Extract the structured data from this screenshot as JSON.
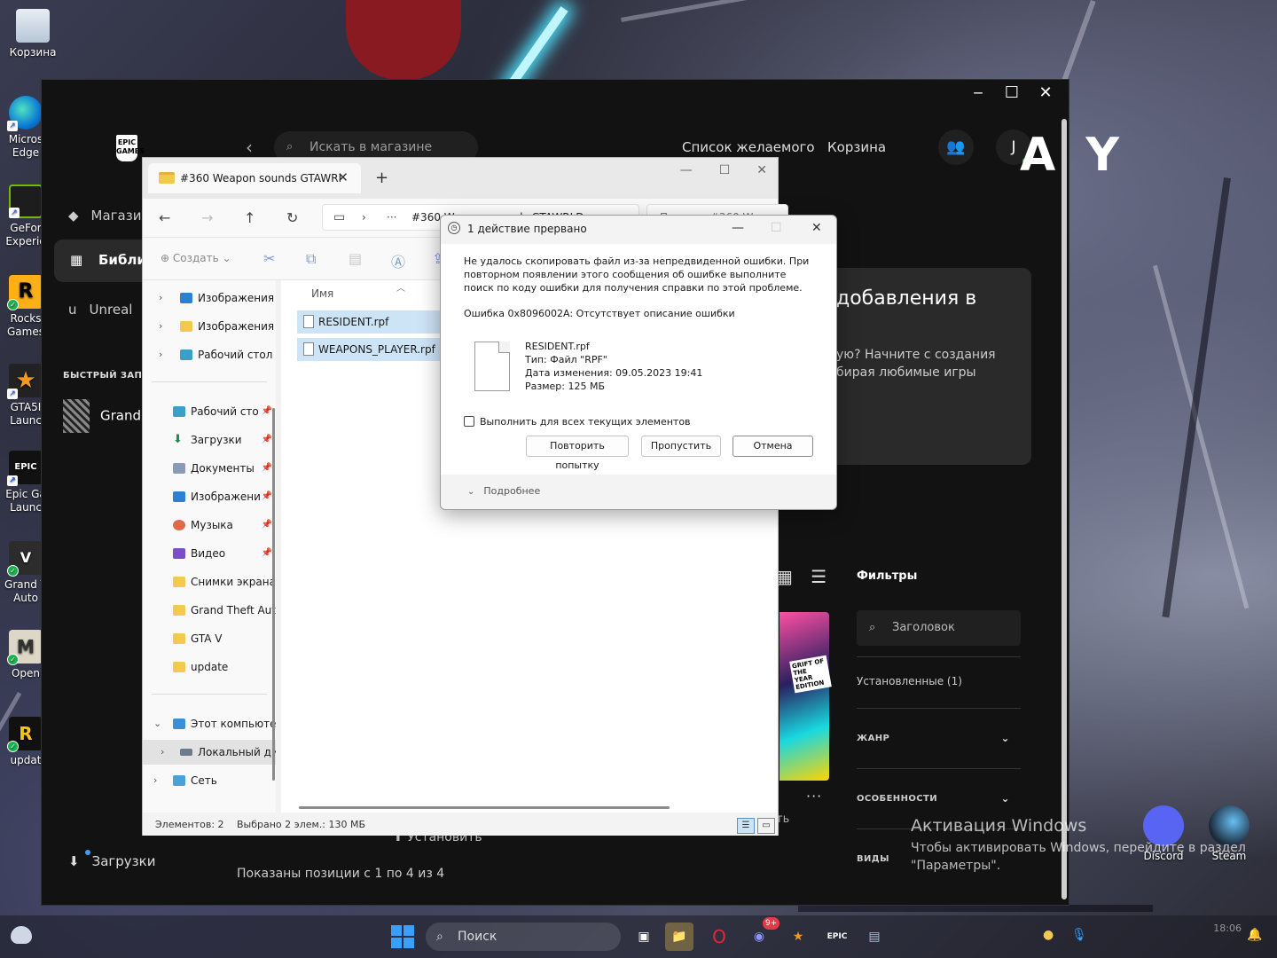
{
  "desktop": {
    "icons": [
      {
        "label": "Корзина"
      },
      {
        "label": "Micros Edge"
      },
      {
        "label": "GeFor Experie"
      },
      {
        "label": "Rocks Games"
      },
      {
        "label": "GTA5I Launc"
      },
      {
        "label": "Epic Ga Launc"
      },
      {
        "label": "Grand T Auto"
      },
      {
        "label": "Open"
      },
      {
        "label": "updat"
      }
    ],
    "right_apps": [
      {
        "label": "Discord"
      },
      {
        "label": "Steam"
      }
    ],
    "activation": {
      "title": "Активация Windows",
      "line1": "Чтобы активировать Windows, перейдите в раздел",
      "line2": "\"Параметры\"."
    }
  },
  "epic": {
    "logo": "EPIC GAMES",
    "search_placeholder": "Искать в магазине",
    "wishlist": "Список желаемого",
    "cart": "Корзина",
    "avatar_letter": "J",
    "sidebar": {
      "store": "Магазин",
      "library": "Библиотека",
      "unreal": "Unreal",
      "quick_launch": "БЫСТРЫЙ ЗАПУСК",
      "gta": "Grand T",
      "downloads": "Загрузки"
    },
    "card": {
      "title": "добавления в",
      "text": "ую? Начните с создания бирая любимые игры"
    },
    "filters": {
      "title": "Фильтры",
      "search_placeholder": "Заголовок",
      "installed": "Установленные (1)",
      "genre": "ЖАНР",
      "features": "ОСОБЕННОСТИ",
      "types": "ВИДЫ"
    },
    "game_cover_label": "GRIFT OF THE YEAR EDITION",
    "more": "···",
    "ts": "ть",
    "install": "Установить",
    "shown": "Показаны позиции с 1 по 4 из 4",
    "brand": "A Y"
  },
  "explorer": {
    "tab_title": "#360 Weapon sounds GTAWRI",
    "address": "#360 Weapon sounds GTAWRLD",
    "search_placeholder": "Поиск в: #360 Weapo",
    "create": "Создать",
    "nav": [
      {
        "label": "Изображения"
      },
      {
        "label": "Изображения"
      },
      {
        "label": "Рабочий стол"
      },
      {
        "label": "Рабочий сто"
      },
      {
        "label": "Загрузки"
      },
      {
        "label": "Документы"
      },
      {
        "label": "Изображени"
      },
      {
        "label": "Музыка"
      },
      {
        "label": "Видео"
      },
      {
        "label": "Снимки экрана"
      },
      {
        "label": "Grand Theft Aut"
      },
      {
        "label": "GTA V"
      },
      {
        "label": "update"
      },
      {
        "label": "Этот компьюте"
      },
      {
        "label": "Локальный ди"
      },
      {
        "label": "Сеть"
      }
    ],
    "column_name": "Имя",
    "files": [
      {
        "name": "RESIDENT.rpf"
      },
      {
        "name": "WEAPONS_PLAYER.rpf"
      }
    ],
    "status_count": "Элементов: 2",
    "status_selected": "Выбрано 2 элем.: 130 МБ"
  },
  "dialog": {
    "title": "1 действие прервано",
    "message": "Не удалось скопировать файл из-за непредвиденной ошибки. При повторном появлении этого сообщения об ошибке выполните поиск по коду ошибки для получения справки по этой проблеме.",
    "error": "Ошибка 0x8096002A: Отсутствует описание ошибки",
    "file_name": "RESIDENT.rpf",
    "file_type": "Тип: Файл \"RPF\"",
    "file_date": "Дата изменения: 09.05.2023 19:41",
    "file_size": "Размер: 125 МБ",
    "apply_all": "Выполнить для всех текущих элементов",
    "retry": "Повторить попытку",
    "skip": "Пропустить",
    "cancel": "Отмена",
    "details": "Подробнее"
  },
  "taskbar": {
    "search_placeholder": "Поиск",
    "discord_badge": "9+",
    "time": "18:06"
  }
}
